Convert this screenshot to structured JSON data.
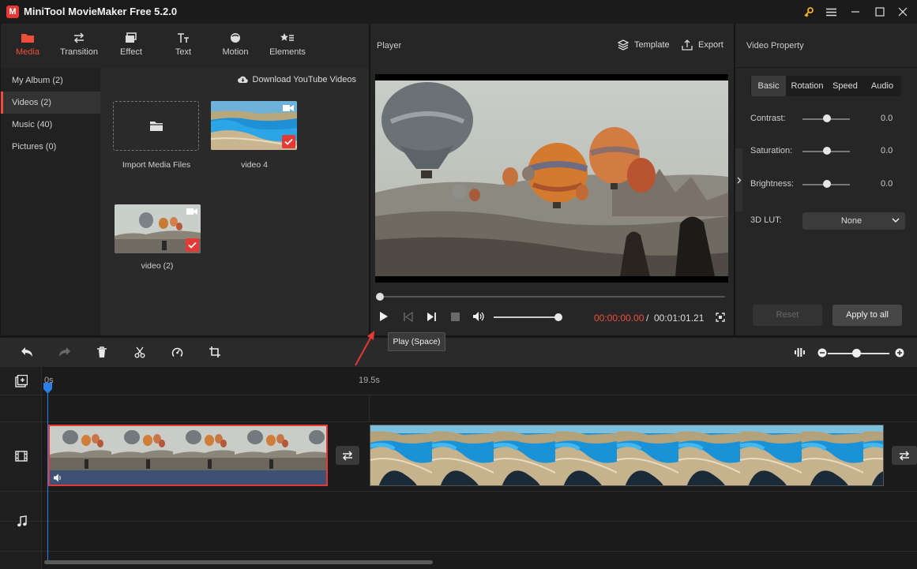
{
  "window": {
    "title": "MiniTool MovieMaker Free 5.2.0",
    "logo_letter": "M"
  },
  "media_tabs": [
    {
      "label": "Media",
      "icon": "folder-icon",
      "active": true
    },
    {
      "label": "Transition",
      "icon": "swap-arrows-icon"
    },
    {
      "label": "Effect",
      "icon": "layers-icon"
    },
    {
      "label": "Text",
      "icon": "text-t-icon"
    },
    {
      "label": "Motion",
      "icon": "motion-ball-icon"
    },
    {
      "label": "Elements",
      "icon": "star-list-icon"
    }
  ],
  "media_sidebar": [
    {
      "label": "My Album (2)"
    },
    {
      "label": "Videos (2)",
      "active": true
    },
    {
      "label": "Music (40)"
    },
    {
      "label": "Pictures (0)"
    }
  ],
  "media_main": {
    "download_label": "Download YouTube Videos",
    "import_label": "Import Media Files",
    "items": [
      {
        "caption": "video 4",
        "checked": true
      },
      {
        "caption": "video (2)",
        "checked": true
      }
    ]
  },
  "player": {
    "title": "Player",
    "template_label": "Template",
    "export_label": "Export",
    "time_current": "00:00:00.00",
    "time_separator": "/",
    "time_total": "00:01:01.21",
    "tooltip": "Play (Space)",
    "seek_fraction": 0.0,
    "volume_fraction": 1.0
  },
  "properties": {
    "title": "Video Property",
    "tabs": [
      "Basic",
      "Rotation",
      "Speed",
      "Audio"
    ],
    "active_tab": "Basic",
    "sliders": [
      {
        "label": "Contrast:",
        "value": "0.0"
      },
      {
        "label": "Saturation:",
        "value": "0.0"
      },
      {
        "label": "Brightness:",
        "value": "0.0"
      }
    ],
    "lut_label": "3D LUT:",
    "lut_value": "None",
    "reset_label": "Reset",
    "apply_label": "Apply to all"
  },
  "timeline": {
    "ruler": [
      "0s",
      "19.5s"
    ],
    "accent": "#2b7fe8",
    "selected_clip_color": "#e53935"
  },
  "colors": {
    "accent": "#ef4f3a",
    "background": "#161616",
    "panel": "#262626"
  }
}
